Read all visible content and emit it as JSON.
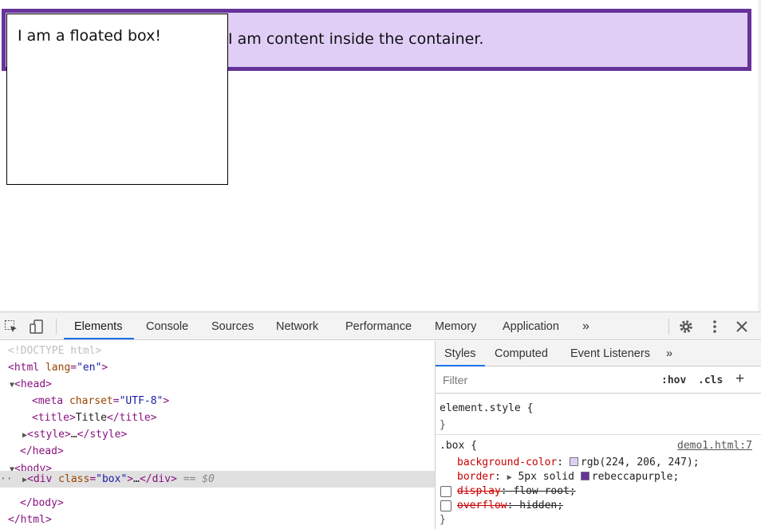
{
  "viewport": {
    "floated_box_text": "I am a floated box!",
    "container_text": "I am content inside the container."
  },
  "devtools": {
    "tabs": [
      "Elements",
      "Console",
      "Sources",
      "Network",
      "Performance",
      "Memory",
      "Application"
    ],
    "active_tab": "Elements",
    "more_tabs_label": "»",
    "icons": [
      "inspect-element-icon",
      "device-toolbar-icon",
      "settings-gear-icon",
      "kebab-menu-icon",
      "close-icon"
    ],
    "dom_tree": {
      "doctype": "<!DOCTYPE html>",
      "html_open_tag": "html",
      "html_lang_attr": "lang",
      "html_lang_val": "\"en\"",
      "head_tag": "head",
      "meta_tag": "meta",
      "meta_attr": "charset",
      "meta_val": "\"UTF-8\"",
      "title_tag": "title",
      "title_text": "Title",
      "style_tag": "style",
      "ellipsis": "…",
      "body_tag": "body",
      "div_tag": "div",
      "div_attr": "class",
      "div_val": "\"box\"",
      "selected_marker": "== $0",
      "gutter_dots": "··"
    },
    "styles_panel": {
      "tabs": [
        "Styles",
        "Computed",
        "Event Listeners"
      ],
      "active_tab": "Styles",
      "more_label": "»",
      "filter_placeholder": "Filter",
      "hov_label": ":hov",
      "cls_label": ".cls",
      "add_rule_label": "+",
      "element_style_selector": "element.style {",
      "close_brace": "}",
      "box_selector": ".box {",
      "source_link": "demo1.html:7",
      "declarations": [
        {
          "prop": "background-color",
          "value": "rgb(224, 206, 247);",
          "swatch": "#e0cef7",
          "checkbox": false,
          "struck": false
        },
        {
          "prop": "border",
          "value": "5px solid",
          "value2": "rebeccapurple;",
          "swatch": "#663399",
          "expandable": true,
          "checkbox": false,
          "struck": false
        },
        {
          "prop": "display",
          "value": "flow-root;",
          "checkbox": true,
          "struck": true
        },
        {
          "prop": "overflow",
          "value": "hidden;",
          "checkbox": true,
          "struck": true
        }
      ]
    }
  }
}
